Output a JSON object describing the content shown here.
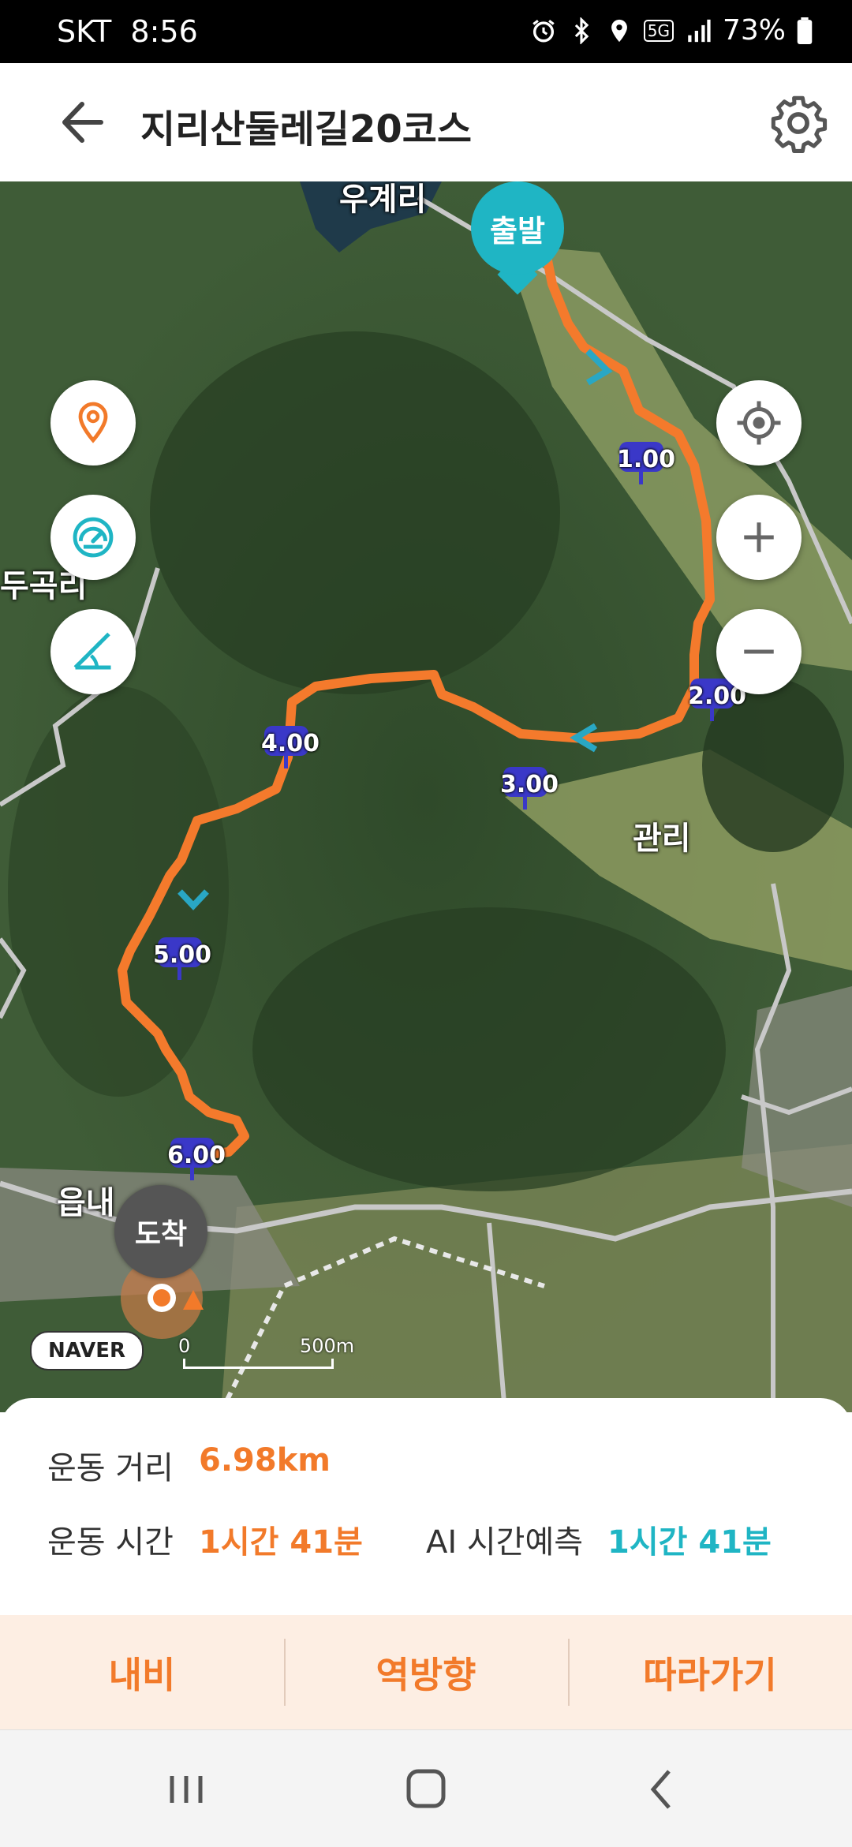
{
  "status_bar": {
    "carrier": "SKT",
    "time": "8:56",
    "network": "5G",
    "battery": "73%"
  },
  "header": {
    "title": "지리산둘레길20코스"
  },
  "map": {
    "place_labels": [
      "우계리",
      "두곡리",
      "관리",
      "읍내"
    ],
    "start_label": "출발",
    "end_label": "도착",
    "km_markers": [
      "1.00",
      "2.00",
      "3.00",
      "4.00",
      "5.00",
      "6.00"
    ],
    "provider": "NAVER",
    "scale": {
      "zero": "0",
      "distance": "500m"
    },
    "route_color": "#f47a2c"
  },
  "summary": {
    "distance_label": "운동 거리",
    "distance_value": "6.98km",
    "time_label": "운동 시간",
    "time_value": "1시간 41분",
    "ai_label": "AI 시간예측",
    "ai_value": "1시간 41분"
  },
  "actions": {
    "navigate": "내비",
    "reverse": "역방향",
    "follow": "따라가기"
  },
  "colors": {
    "accent": "#f27a2a",
    "teal": "#1fb5c4"
  }
}
